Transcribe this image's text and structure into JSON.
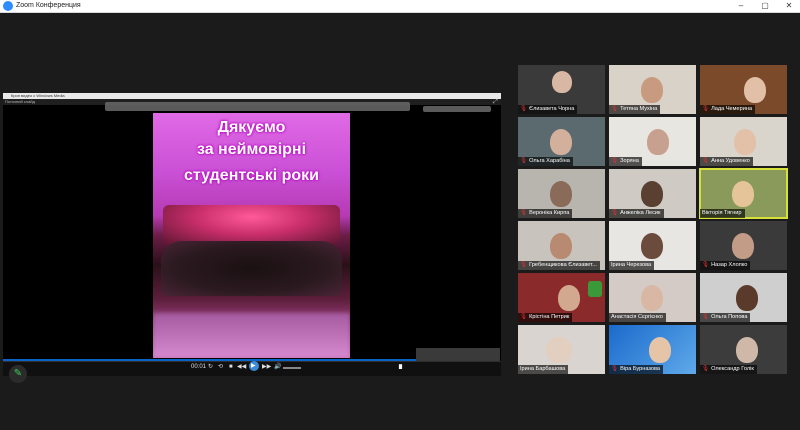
{
  "app": {
    "title": "Zoom Конференция",
    "logo_color": "#2d8cff"
  },
  "window_controls": {
    "minimize": "–",
    "maximize": "▢",
    "close": "✕"
  },
  "shared_window": {
    "title": "Кроп видео с Windows Media",
    "menu": "Поточний слайд",
    "slide": {
      "line1": "Дякуємо",
      "line2": "за неймовірні",
      "line3": "студентські роки"
    },
    "time": "00:01",
    "controls": [
      "↻",
      "⟲",
      "■",
      "◀◀",
      "▶▶",
      "🔊"
    ],
    "play_icon": "▶"
  },
  "presenter_tool": {
    "icon": "✎"
  },
  "participants": [
    {
      "name": "Єлизавета Чорна",
      "muted": true
    },
    {
      "name": "Тетяна Мухіна",
      "muted": true
    },
    {
      "name": "Лада Чемерина",
      "muted": true
    },
    {
      "name": "Ольга Харабіна",
      "muted": true
    },
    {
      "name": "Зоряна",
      "muted": true
    },
    {
      "name": "Анна Удовенко",
      "muted": true
    },
    {
      "name": "Вероніка Кирпа",
      "muted": true
    },
    {
      "name": "Анжеліка Лесик",
      "muted": true
    },
    {
      "name": "Вікторія Тягнир",
      "muted": false,
      "active": true
    },
    {
      "name": "Гребенщикова Єлизавет...",
      "muted": true
    },
    {
      "name": "Ірина Черезова",
      "muted": false
    },
    {
      "name": "Назар Хлопко",
      "muted": true
    },
    {
      "name": "Крістіна Петрик",
      "muted": true
    },
    {
      "name": "Анастасія Сєргієнко",
      "muted": false
    },
    {
      "name": "Ольга Попова",
      "muted": true
    },
    {
      "name": "Ірина Барбашова",
      "muted": false
    },
    {
      "name": "Віра Бурназова",
      "muted": true
    },
    {
      "name": "Олександр Голік",
      "muted": true
    }
  ],
  "colors": {
    "active_speaker": "#d8e03a",
    "muted_icon": "#e0322f",
    "progress": "#0a63c7"
  }
}
